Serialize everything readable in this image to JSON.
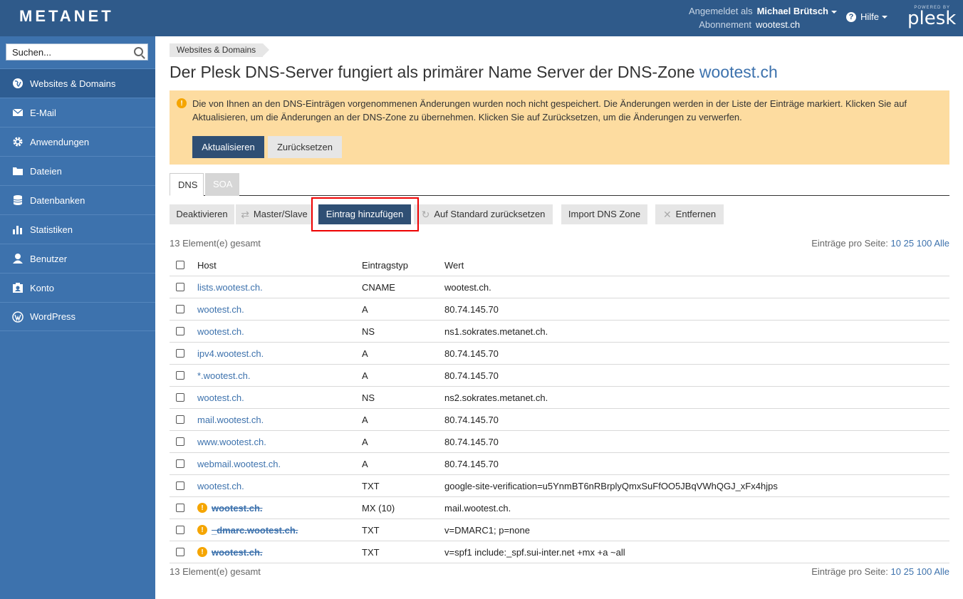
{
  "header": {
    "logo": "METANET",
    "logged_in_label": "Angemeldet als",
    "user_name": "Michael Brütsch",
    "subscription_label": "Abonnement",
    "subscription_value": "wootest.ch",
    "help_label": "Hilfe",
    "powered_by": "POWERED BY",
    "brand": "plesk"
  },
  "sidebar": {
    "search_placeholder": "Suchen...",
    "items": [
      {
        "label": "Websites & Domains",
        "icon": "globe-icon",
        "active": true
      },
      {
        "label": "E-Mail",
        "icon": "envelope-icon"
      },
      {
        "label": "Anwendungen",
        "icon": "gear-icon"
      },
      {
        "label": "Dateien",
        "icon": "folder-icon"
      },
      {
        "label": "Datenbanken",
        "icon": "database-icon"
      },
      {
        "label": "Statistiken",
        "icon": "bar-chart-icon"
      },
      {
        "label": "Benutzer",
        "icon": "user-icon"
      },
      {
        "label": "Konto",
        "icon": "account-icon"
      },
      {
        "label": "WordPress",
        "icon": "wordpress-icon"
      }
    ]
  },
  "main": {
    "breadcrumb": "Websites & Domains",
    "title_prefix": "Der Plesk DNS-Server fungiert als primärer Name Server der DNS-Zone",
    "title_domain": "wootest.ch",
    "warning_text": "Die von Ihnen an den DNS-Einträgen vorgenommenen Änderungen wurden noch nicht gespeichert. Die Änderungen werden in der Liste der Einträge markiert. Klicken Sie auf Aktualisieren, um die Änderungen an der DNS-Zone zu übernehmen. Klicken Sie auf Zurücksetzen, um die Änderungen zu verwerfen.",
    "update_button": "Aktualisieren",
    "reset_button": "Zurücksetzen",
    "tabs": [
      {
        "label": "DNS"
      },
      {
        "label": "SOA"
      }
    ],
    "toolbar": {
      "deactivate": "Deaktivieren",
      "master_slave": "Master/Slave",
      "add_entry": "Eintrag hinzufügen",
      "reset_default": "Auf Standard zurücksetzen",
      "import_zone": "Import DNS Zone",
      "remove": "Entfernen"
    },
    "total_count": "13 Element(e) gesamt",
    "per_page_label": "Einträge pro Seite:",
    "per_page_options": [
      "10",
      "25",
      "100",
      "Alle"
    ],
    "columns": {
      "host": "Host",
      "type": "Eintragstyp",
      "value": "Wert"
    },
    "rows": [
      {
        "host": "lists.wootest.ch.",
        "type": "CNAME",
        "value": "wootest.ch.",
        "pending": false
      },
      {
        "host": "wootest.ch.",
        "type": "A",
        "value": "80.74.145.70",
        "pending": false
      },
      {
        "host": "wootest.ch.",
        "type": "NS",
        "value": "ns1.sokrates.metanet.ch.",
        "pending": false
      },
      {
        "host": "ipv4.wootest.ch.",
        "type": "A",
        "value": "80.74.145.70",
        "pending": false
      },
      {
        "host": "*.wootest.ch.",
        "type": "A",
        "value": "80.74.145.70",
        "pending": false
      },
      {
        "host": "wootest.ch.",
        "type": "NS",
        "value": "ns2.sokrates.metanet.ch.",
        "pending": false
      },
      {
        "host": "mail.wootest.ch.",
        "type": "A",
        "value": "80.74.145.70",
        "pending": false
      },
      {
        "host": "www.wootest.ch.",
        "type": "A",
        "value": "80.74.145.70",
        "pending": false
      },
      {
        "host": "webmail.wootest.ch.",
        "type": "A",
        "value": "80.74.145.70",
        "pending": false
      },
      {
        "host": "wootest.ch.",
        "type": "TXT",
        "value": "google-site-verification=u5YnmBT6nRBrplyQmxSuFfOO5JBqVWhQGJ_xFx4hjps",
        "pending": false
      },
      {
        "host": "wootest.ch.",
        "type": "MX (10)",
        "value": "mail.wootest.ch.",
        "pending": true
      },
      {
        "host": "_dmarc.wootest.ch.",
        "type": "TXT",
        "value": "v=DMARC1; p=none",
        "pending": true
      },
      {
        "host": "wootest.ch.",
        "type": "TXT",
        "value": "v=spf1 include:_spf.sui-inter.net +mx +a ~all",
        "pending": true
      }
    ]
  },
  "colors": {
    "header_bg": "#2f5a8a",
    "sidebar_bg": "#3d72ad",
    "link": "#3d72ad",
    "primary_button": "#2f4f74",
    "warning_bg": "#fddca0",
    "highlight_border": "#e00000"
  }
}
